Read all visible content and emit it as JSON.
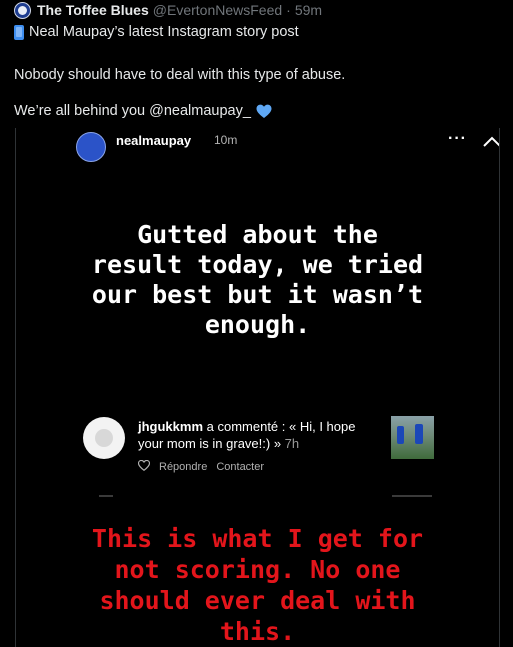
{
  "tweet": {
    "display_name": "The Toffee Blues",
    "handle": "@EvertonNewsFeed",
    "separator": "·",
    "time": "59m",
    "line1": "Neal Maupay’s latest Instagram story post",
    "line2": "Nobody should have to deal with this type of abuse.",
    "line3": "We’re all behind you @nealmaupay_"
  },
  "story": {
    "username": "nealmaupay",
    "posted_ago": "10m",
    "more_label": "···",
    "caption_top": [
      "Gutted about the",
      "result today, we tried",
      "our best but it wasn’t",
      "enough."
    ],
    "comment": {
      "user": "jhgukkmm",
      "text_line1": " a commenté : « Hi, I hope",
      "text_line2": "your mom is in grave!:) »",
      "time": " 7h",
      "reply": "Répondre",
      "contact": "Contacter"
    },
    "caption_bottom": [
      "This is what I get for",
      "not scoring. No one",
      "should ever deal with",
      "this."
    ]
  },
  "colors": {
    "background": "#000000",
    "muted": "#71767b",
    "heart": "#5fa8f5",
    "caption_red": "#e3151b"
  }
}
